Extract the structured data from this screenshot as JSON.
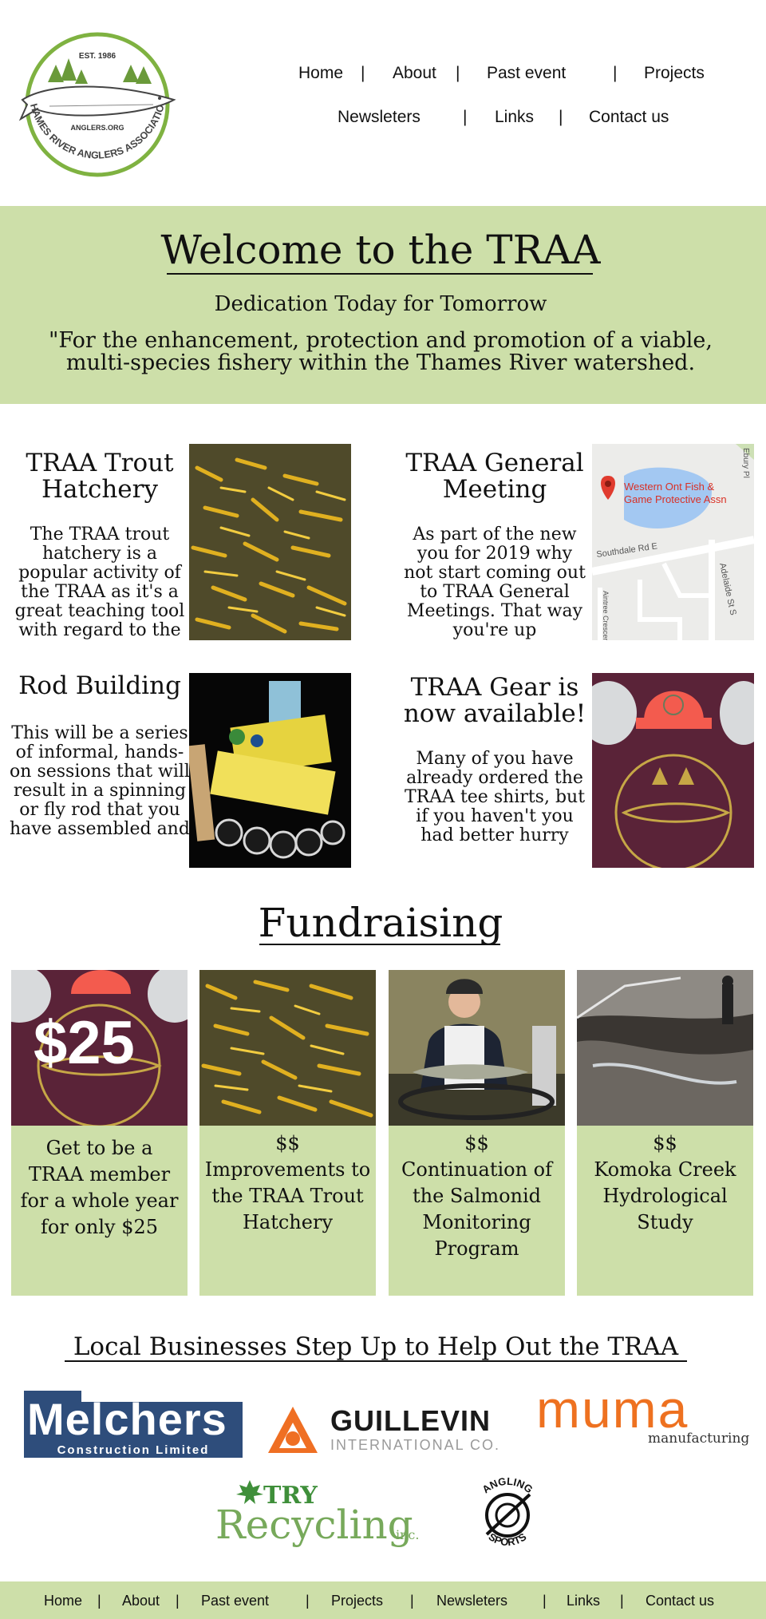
{
  "logo": {
    "est": "EST. 1986",
    "site": "ANGLERS.ORG",
    "org": "THAMES RIVER ANGLERS ASSOCIATION"
  },
  "nav": {
    "items": [
      "Home",
      "About",
      "Past event",
      "Projects",
      "Newsleters",
      "Links",
      "Contact us"
    ]
  },
  "banner": {
    "title": "Welcome to the TRAA",
    "subtitle": "Dedication Today for Tomorrow",
    "quote_line1": "\"For the enhancement, protection and promotion of a viable,",
    "quote_line2": "multi-species fishery within the Thames River watershed."
  },
  "cards": [
    {
      "title": "TRAA Trout Hatchery",
      "text": "The TRAA trout hatchery is a popular activity of the TRAA as it's a great teaching tool with regard to the"
    },
    {
      "title": "TRAA General Meeting",
      "text": "As part of the new you for 2019 why not start coming out to TRAA General Meetings. That way you're up"
    },
    {
      "title": "Rod Building",
      "text": "This will be a series of informal, hands-on sessions that will result in a spinning or fly rod that you have assembled and"
    },
    {
      "title": "TRAA Gear is now available!",
      "text": "Many of you have already ordered the TRAA tee shirts, but if you haven't you had better hurry"
    }
  ],
  "map": {
    "place": "Western Ont Fish & Game Protective Assn",
    "road": "Southdale Rd E",
    "street1": "Adelaide St S",
    "street2": "Ebury Pl",
    "street3": "Aintree Crescent"
  },
  "fundraising": {
    "heading": "Fundraising",
    "price_overlay": "$25",
    "items": [
      {
        "text": "Get to be a TRAA member for a whole year for only $25"
      },
      {
        "amount": "$$",
        "text": "Improvements to the TRAA Trout Hatchery"
      },
      {
        "amount": "$$",
        "text": "Continuation of the Salmonid Monitoring Program"
      },
      {
        "amount": "$$",
        "text": "Komoka Creek Hydrological Study"
      }
    ]
  },
  "sponsors": {
    "heading": "Local Businesses Step Up to Help Out the TRAA",
    "melchers": {
      "name": "Melchers",
      "sub": "Construction Limited"
    },
    "guillevin": {
      "name": "GUILLEVIN",
      "sub": "INTERNATIONAL CO."
    },
    "muma": {
      "name": "muma",
      "sub": "manufacturing"
    },
    "try": {
      "top": "TRY",
      "name": "Recycling",
      "suffix": "inc."
    },
    "angling": {
      "top": "ANGLING",
      "bottom": "SPORTS"
    }
  },
  "colors": {
    "banner_green": "#cddfa9",
    "footer_green": "#cddfa9",
    "logo_green": "#7fb241",
    "melchers_blue": "#2e4d7b",
    "muma_orange": "#ee7120",
    "guillevin_orange": "#ef6f23"
  }
}
